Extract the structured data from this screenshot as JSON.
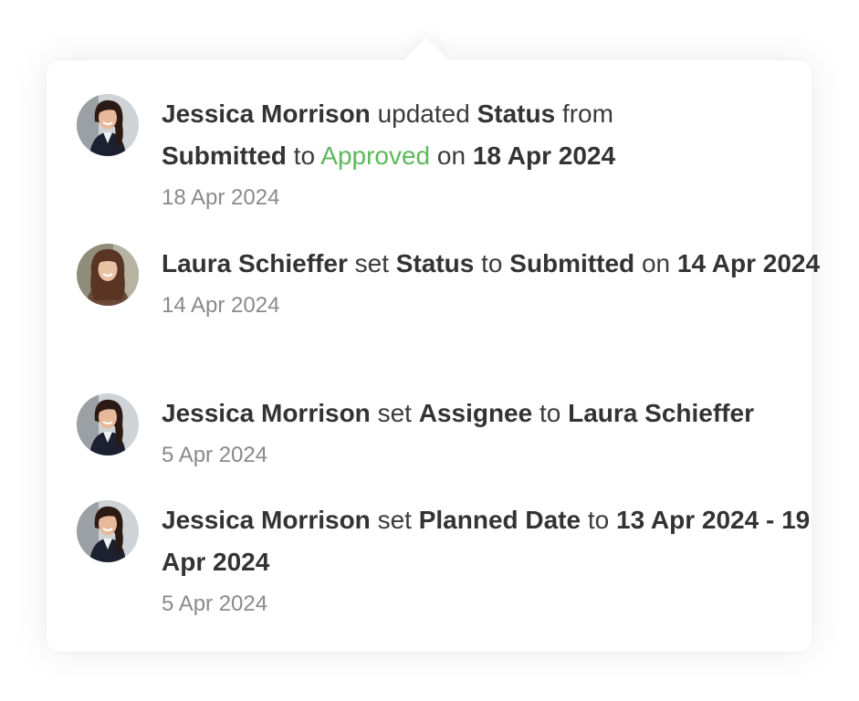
{
  "entries": [
    {
      "user": "Jessica Morrison",
      "w1": "updated",
      "field": "Status",
      "w2": "from",
      "from_value": "Submitted",
      "w3": "to",
      "to_value": "Approved",
      "w4": "on",
      "date": "18 Apr 2024",
      "timestamp": "18 Apr 2024"
    },
    {
      "user": "Laura Schieffer",
      "w1": "set",
      "field": "Status",
      "w2": "to",
      "value": "Submitted",
      "w3": "on",
      "date": "14 Apr 2024",
      "timestamp": "14 Apr 2024"
    },
    {
      "user": "Jessica Morrison",
      "w1": "set",
      "field": "Assignee",
      "w2": "to",
      "value": "Laura Schieffer",
      "timestamp": "5 Apr 2024"
    },
    {
      "user": "Jessica Morrison",
      "w1": "set",
      "field": "Planned Date",
      "w2": "to",
      "value": "13 Apr 2024 - 19 Apr 2024",
      "timestamp": "5 Apr 2024"
    }
  ],
  "colors": {
    "approved": "#5cb85c",
    "text": "#3b3b3b",
    "timestamp": "#8a8a8a"
  }
}
